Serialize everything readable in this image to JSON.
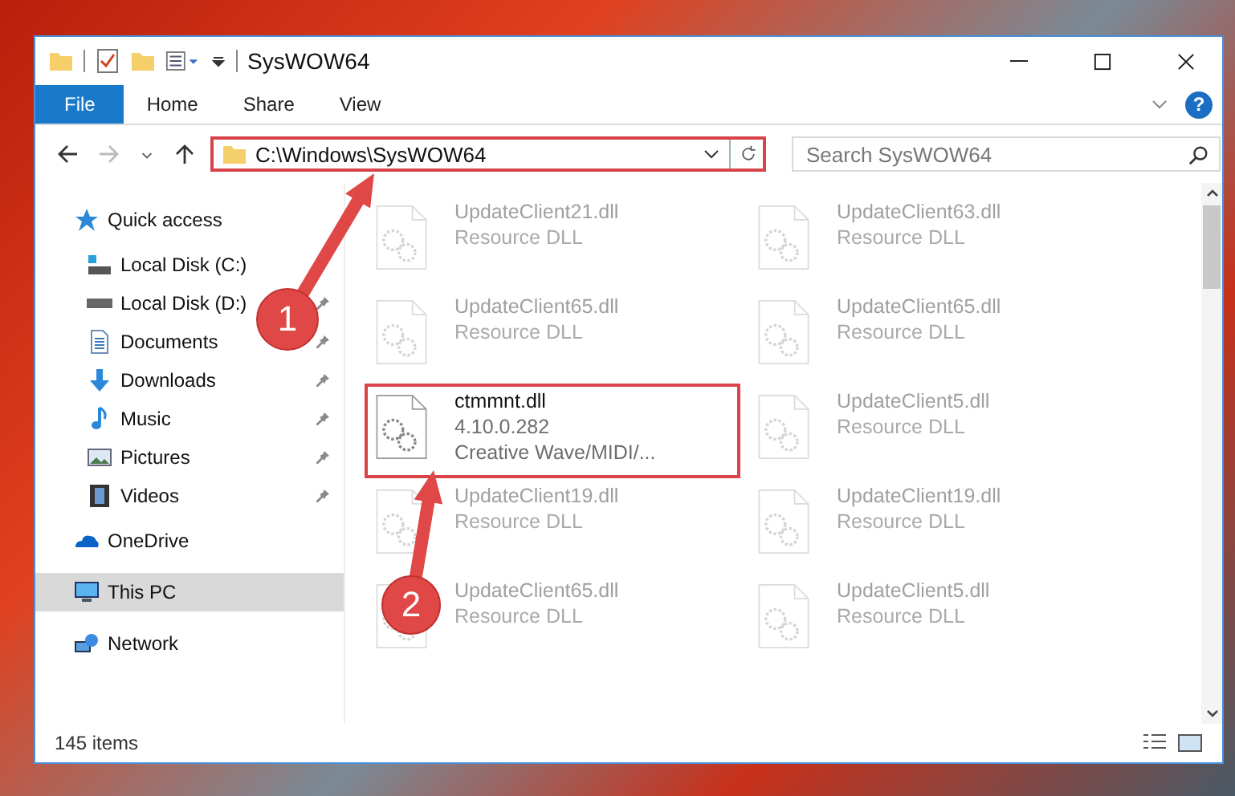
{
  "window": {
    "title": "SysWOW64"
  },
  "ribbon": {
    "tabs": [
      {
        "label": "File",
        "kind": "file"
      },
      {
        "label": "Home",
        "kind": "tab"
      },
      {
        "label": "Share",
        "kind": "tab"
      },
      {
        "label": "View",
        "kind": "tab"
      }
    ],
    "help": "?"
  },
  "navigation": {
    "forward_disabled": true
  },
  "address_bar": {
    "path": "C:\\Windows\\SysWOW64",
    "highlighted": true
  },
  "search": {
    "placeholder": "Search SysWOW64"
  },
  "sidebar": {
    "items": [
      {
        "label": "Quick access",
        "kind": "star",
        "selected": false,
        "children": [
          {
            "label": "Local Disk (C:)",
            "kind": "system-drive",
            "pinned": false
          },
          {
            "label": "Local Disk (D:)",
            "kind": "drive",
            "pinned": true
          },
          {
            "label": "Documents",
            "kind": "document",
            "pinned": true
          },
          {
            "label": "Downloads",
            "kind": "download",
            "pinned": true
          },
          {
            "label": "Music",
            "kind": "music",
            "pinned": true
          },
          {
            "label": "Pictures",
            "kind": "pictures",
            "pinned": true
          },
          {
            "label": "Videos",
            "kind": "videos",
            "pinned": true
          }
        ]
      },
      {
        "label": "OneDrive",
        "kind": "cloud",
        "selected": false
      },
      {
        "label": "This PC",
        "kind": "computer",
        "selected": true
      },
      {
        "label": "Network",
        "kind": "network",
        "selected": false
      }
    ]
  },
  "files": [
    {
      "name": "UpdateClient21.dll",
      "details": [
        "Resource DLL"
      ],
      "faded": true,
      "highlighted": false
    },
    {
      "name": "UpdateClient63.dll",
      "details": [
        "Resource DLL"
      ],
      "faded": true,
      "highlighted": false
    },
    {
      "name": "UpdateClient65.dll",
      "details": [
        "Resource DLL"
      ],
      "faded": true,
      "highlighted": false
    },
    {
      "name": "UpdateClient65.dll",
      "details": [
        "Resource DLL"
      ],
      "faded": true,
      "highlighted": false
    },
    {
      "name": "ctmmnt.dll",
      "details": [
        "4.10.0.282",
        "Creative Wave/MIDI/..."
      ],
      "faded": false,
      "highlighted": true
    },
    {
      "name": "UpdateClient5.dll",
      "details": [
        "Resource DLL"
      ],
      "faded": true,
      "highlighted": false
    },
    {
      "name": "UpdateClient19.dll",
      "details": [
        "Resource DLL"
      ],
      "faded": true,
      "highlighted": false
    },
    {
      "name": "UpdateClient19.dll",
      "details": [
        "Resource DLL"
      ],
      "faded": true,
      "highlighted": false
    },
    {
      "name": "UpdateClient65.dll",
      "details": [
        "Resource DLL"
      ],
      "faded": true,
      "highlighted": false
    },
    {
      "name": "UpdateClient5.dll",
      "details": [
        "Resource DLL"
      ],
      "faded": true,
      "highlighted": false
    }
  ],
  "status_bar": {
    "item_count": "145 items"
  },
  "annotations": [
    {
      "number": "1"
    },
    {
      "number": "2"
    }
  ]
}
